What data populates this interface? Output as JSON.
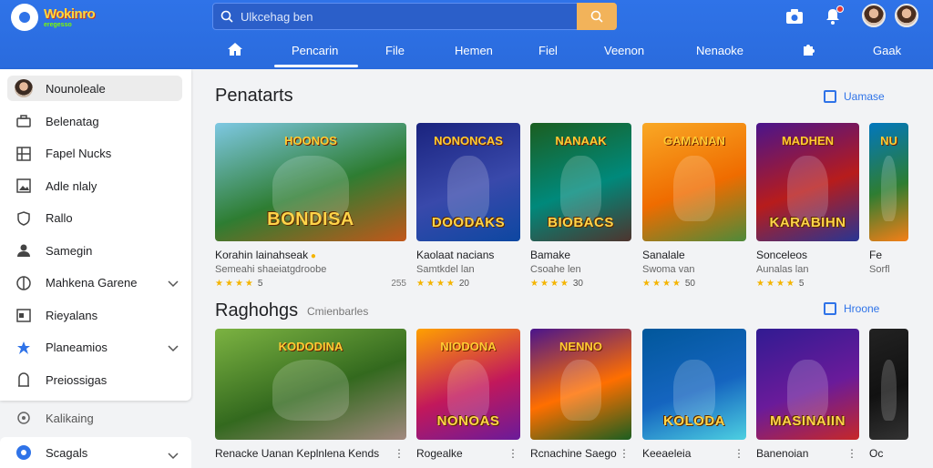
{
  "brand": {
    "name": "Wokinro",
    "tagline": "eregesso"
  },
  "search": {
    "placeholder": "Ulkcehag ben"
  },
  "nav": {
    "items": [
      "Pencarin",
      "File",
      "Hemen",
      "Fiel",
      "Veenon",
      "Nenaoke",
      "Gaak"
    ],
    "active": "Pencarin"
  },
  "sidebar": {
    "profile": "Nounoleale",
    "items": [
      {
        "label": "Belenatag",
        "icon": "briefcase-icon"
      },
      {
        "label": "Fapel Nucks",
        "icon": "grid-icon"
      },
      {
        "label": "Adle nlaly",
        "icon": "image-icon"
      },
      {
        "label": "Rallo",
        "icon": "shield-icon"
      },
      {
        "label": "Samegin",
        "icon": "user-icon"
      },
      {
        "label": "Mahkena Garene",
        "icon": "globe-icon",
        "expand": true
      },
      {
        "label": "Rieyalans",
        "icon": "calendar-icon"
      },
      {
        "label": "Planeamios",
        "icon": "star-icon",
        "expand": true
      },
      {
        "label": "Preiossigas",
        "icon": "bag-icon"
      }
    ],
    "extra": [
      {
        "label": "Kalikaing",
        "icon": "refresh-icon"
      },
      {
        "label": "Scagals",
        "icon": "settings-icon",
        "expand": true
      }
    ]
  },
  "sections": [
    {
      "title": "Penatarts",
      "subtitle": "",
      "action": "Uamase",
      "cards": [
        {
          "thumb_top": "HOONOS",
          "thumb_label": "BONDISA",
          "title": "Korahin lainahseak",
          "sub": "Semeahi shaeiatgdroobe",
          "rating": "5",
          "extra": "255",
          "colors": [
            "#7ec8e3",
            "#2e7d32",
            "#c2571a"
          ]
        },
        {
          "thumb_top": "NONONCAS",
          "thumb_label": "DOODAKS",
          "title": "Kaolaat nacians",
          "sub": "Samtkdel lan",
          "rating": "20",
          "extra": "",
          "colors": [
            "#1a237e",
            "#3949ab",
            "#0d47a1"
          ]
        },
        {
          "thumb_top": "NANAAK",
          "thumb_label": "BIOBACS",
          "title": "Bamake",
          "sub": "Csoahe len",
          "rating": "30",
          "extra": "",
          "colors": [
            "#1b5e20",
            "#00897b",
            "#4e342e"
          ]
        },
        {
          "thumb_top": "GAMANAN",
          "thumb_label": "",
          "title": "Sanalale",
          "sub": "Swoma van",
          "rating": "50",
          "extra": "",
          "colors": [
            "#f9a825",
            "#ef6c00",
            "#4e8a3a"
          ]
        },
        {
          "thumb_top": "MADHEN",
          "thumb_label": "KARABIHN",
          "title": "Sonceleos",
          "sub": "Aunalas lan",
          "rating": "5",
          "extra": "",
          "colors": [
            "#4a148c",
            "#b71c1c",
            "#283593"
          ]
        },
        {
          "thumb_top": "NU",
          "thumb_label": "",
          "title": "Fe",
          "sub": "Sorfl",
          "rating": "",
          "extra": "",
          "colors": [
            "#0277bd",
            "#2e7d32",
            "#f57f17"
          ]
        }
      ]
    },
    {
      "title": "Raghohgs",
      "subtitle": "Cmienbarles",
      "action": "Hroone",
      "cards": [
        {
          "thumb_top": "KODODINA",
          "thumb_label": "",
          "title": "Renacke Uanan Keplnlena Kends",
          "sub": "",
          "colors": [
            "#7cb342",
            "#33691e",
            "#a1887f"
          ]
        },
        {
          "thumb_top": "NIODONA",
          "thumb_label": "NONOAS",
          "title": "Rogealke",
          "sub": "",
          "colors": [
            "#ffa000",
            "#c2185b",
            "#6a1b9a"
          ]
        },
        {
          "thumb_top": "NENNO",
          "thumb_label": "",
          "title": "Rcnachine Saego",
          "sub": "",
          "colors": [
            "#4a148c",
            "#ff6f00",
            "#1b5e20"
          ]
        },
        {
          "thumb_top": "",
          "thumb_label": "KOLODA",
          "title": "Keeaeleia",
          "sub": "",
          "colors": [
            "#01579b",
            "#1565c0",
            "#4dd0e1"
          ]
        },
        {
          "thumb_top": "",
          "thumb_label": "MASINAIIN",
          "title": "Banenoian",
          "sub": "",
          "colors": [
            "#311b92",
            "#6a1b9a",
            "#c62828"
          ]
        },
        {
          "thumb_top": "",
          "thumb_label": "",
          "title": "Oc",
          "sub": "",
          "colors": [
            "#222",
            "#111",
            "#333"
          ]
        }
      ]
    }
  ]
}
